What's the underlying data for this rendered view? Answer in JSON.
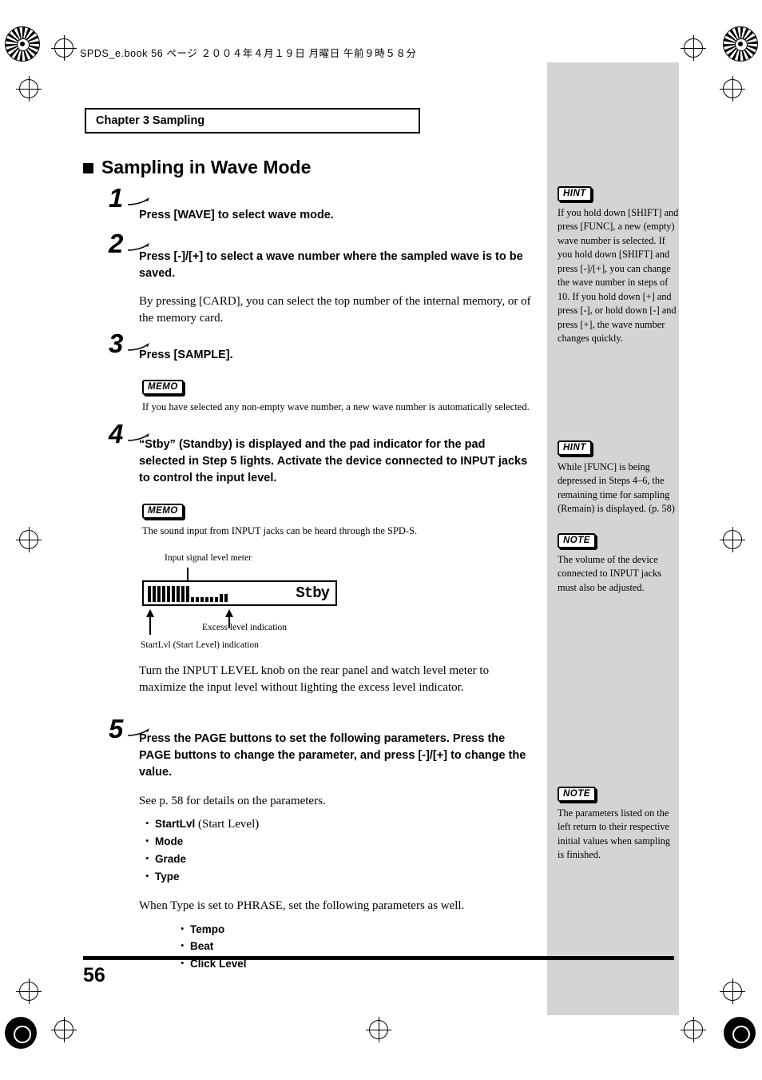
{
  "header": {
    "file_line": "SPDS_e.book  56 ページ  ２００４年４月１９日  月曜日  午前９時５８分"
  },
  "chapter": {
    "label": "Chapter 3 Sampling"
  },
  "title": {
    "text": "Sampling in Wave Mode"
  },
  "steps": [
    {
      "num": "1",
      "head": "Press [WAVE] to select wave mode."
    },
    {
      "num": "2",
      "head": "Press [-]/[+] to select a wave number where the sampled wave is to be saved.",
      "body": "By pressing [CARD], you can select the top number of the internal memory, or of the memory card."
    },
    {
      "num": "3",
      "head": "Press [SAMPLE].",
      "memo_badge": "MEMO",
      "memo_text": "If you have selected any non-empty wave number, a new wave number is automatically selected."
    },
    {
      "num": "4",
      "head": "“Stby” (Standby) is displayed and the pad indicator for the pad selected in Step 5 lights. Activate the device connected to INPUT jacks to control the input level.",
      "memo_badge": "MEMO",
      "memo_text": "The sound input from INPUT jacks can be heard through the SPD-S.",
      "body": "Turn the INPUT LEVEL knob on the rear panel and watch level meter to maximize the input level without lighting the excess level indicator."
    },
    {
      "num": "5",
      "head": "Press the PAGE buttons to set the following parameters. Press the PAGE buttons to change the parameter, and press [-]/[+] to change the value.",
      "body": "See p. 58 for details on the parameters.",
      "params": [
        {
          "name": "StartLvl",
          "note": "(Start Level)"
        },
        {
          "name": "Mode",
          "note": ""
        },
        {
          "name": "Grade",
          "note": ""
        },
        {
          "name": "Type",
          "note": ""
        }
      ],
      "body2": "When Type is set to PHRASE, set the following parameters as well.",
      "params2": [
        {
          "name": "Tempo",
          "note": ""
        },
        {
          "name": "Beat",
          "note": ""
        },
        {
          "name": "Click Level",
          "note": ""
        }
      ]
    }
  ],
  "figure": {
    "label_top": "Input signal level meter",
    "label_excess": "Excess level indication",
    "label_startlvl": "StartLvl (Start Level) indication",
    "lcd_text": "Stby"
  },
  "sidenotes": [
    {
      "badge": "HINT",
      "text": "If you hold down [SHIFT] and press [FUNC], a new (empty) wave number is selected. If you hold down [SHIFT] and press [-]/[+], you can change the wave number in steps of 10. If you hold down [+] and press [-], or hold down [-] and press [+], the wave number changes quickly."
    },
    {
      "badge": "HINT",
      "text": "While [FUNC] is being depressed in Steps 4–6, the remaining time for sampling (Remain) is displayed. (p. 58)"
    },
    {
      "badge": "NOTE",
      "text": "The volume of the device connected to INPUT jacks must also be adjusted."
    },
    {
      "badge": "NOTE",
      "text": "The parameters listed on the left return to their respective initial values when sampling is finished."
    }
  ],
  "footer": {
    "page_number": "56"
  }
}
